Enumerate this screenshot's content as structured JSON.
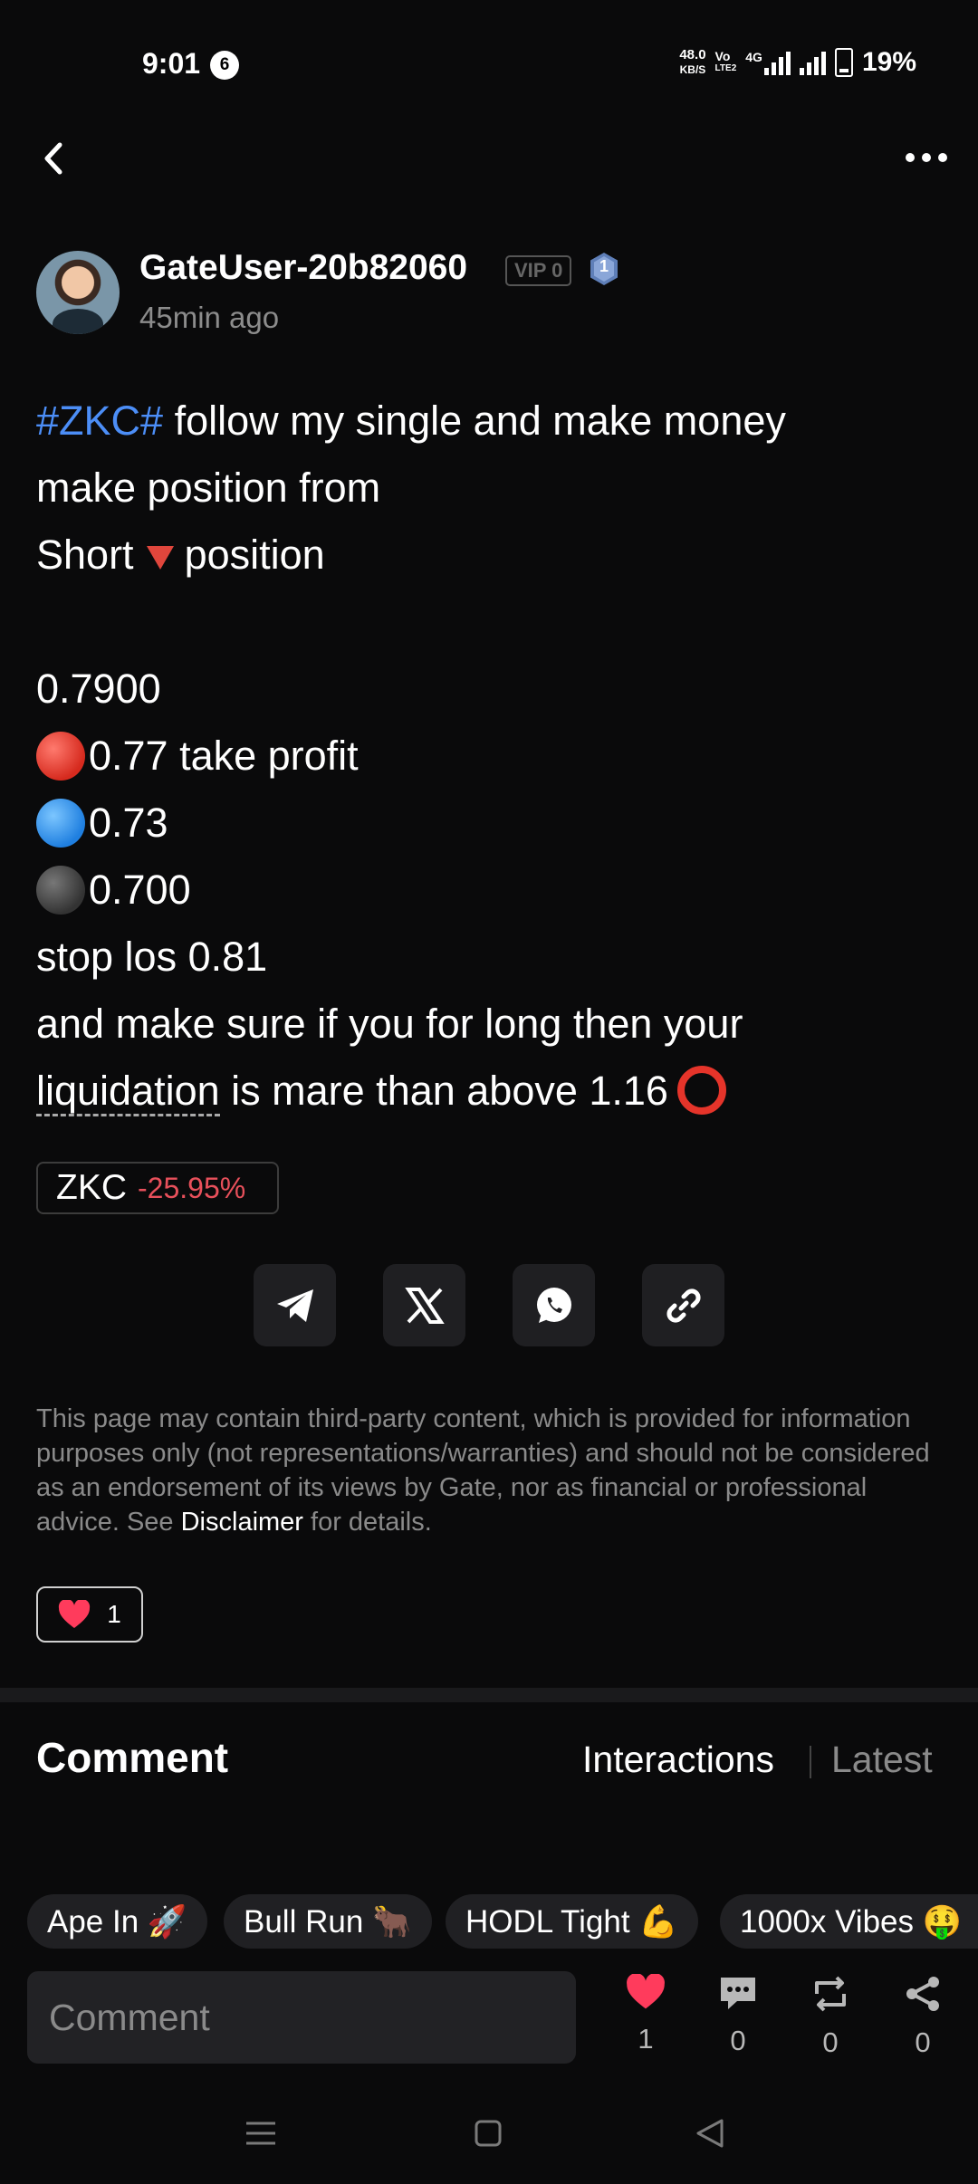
{
  "status_bar": {
    "time": "9:01",
    "notification_count": "6",
    "net_speed_value": "48.0",
    "net_speed_unit": "KB/S",
    "volte_top": "Vo",
    "volte_bottom": "LTE2",
    "network": "4G",
    "battery": "19%"
  },
  "post": {
    "author": "GateUser-20b82060",
    "vip_label": "VIP 0",
    "level": "1",
    "time_ago": "45min ago",
    "hashtag": "#ZKC#",
    "line1_rest": " follow my single and make money",
    "line2": "make position from",
    "line3_a": "Short",
    "line3_b": "position",
    "entry": "0.7900",
    "tp1": "0.77 take profit",
    "tp2": "0.73",
    "tp3": "0.700",
    "stop": "stop los 0.81",
    "line_long": "and make sure if you for long then your",
    "liq_word": "liquidation",
    "liq_rest": " is mare than above 1.16"
  },
  "ticker": {
    "symbol": "ZKC",
    "change": "-25.95%"
  },
  "share": {
    "icons": [
      "telegram-icon",
      "x-icon",
      "whatsapp-icon",
      "link-icon"
    ]
  },
  "disclaimer": {
    "text": "This page may contain third-party content, which is provided for information purposes only (not representations/warranties) and should not be considered as an endorsement of its views by Gate, nor as financial or professional advice. See ",
    "link": "Disclaimer",
    "suffix": " for details."
  },
  "likes": {
    "count": "1"
  },
  "comments": {
    "title": "Comment",
    "tab_interactions": "Interactions",
    "tab_latest": "Latest"
  },
  "reactions": [
    "Ape In 🚀",
    "Bull Run 🐂",
    "HODL Tight 💪",
    "1000x Vibes 🤑"
  ],
  "bottom_bar": {
    "placeholder": "Comment",
    "like_count": "1",
    "comment_count": "0",
    "repost_count": "0",
    "share_count": "0"
  },
  "colors": {
    "background": "#0a0a0b",
    "hashtag": "#4c8ef7",
    "negative": "#e8505b",
    "heart": "#ff3b5c"
  }
}
